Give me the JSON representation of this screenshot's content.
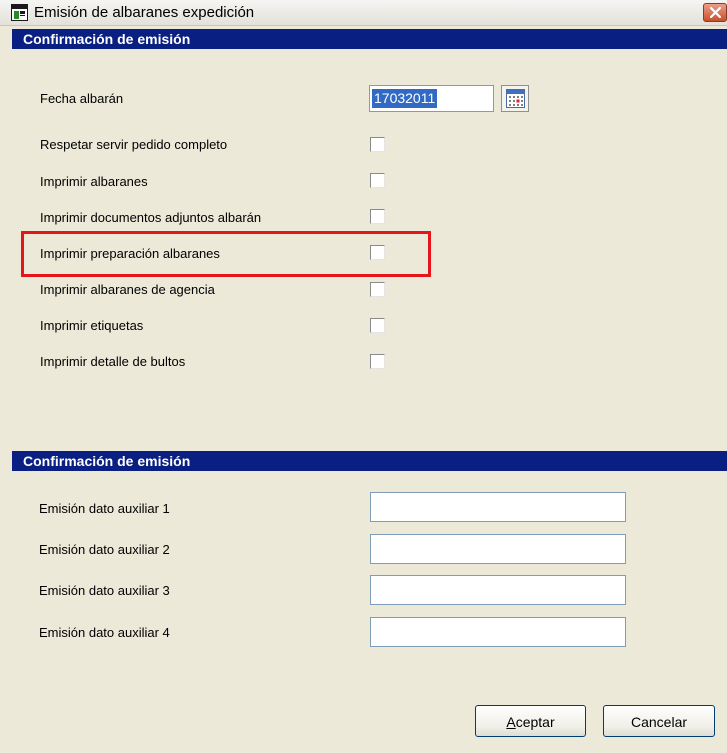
{
  "window": {
    "title": "Emisión de albaranes expedición"
  },
  "section1": {
    "header": "Confirmación de emisión",
    "date": {
      "label": "Fecha albarán",
      "value": "17032011"
    },
    "options": [
      {
        "label": "Respetar servir pedido completo",
        "checked": false
      },
      {
        "label": "Imprimir albaranes",
        "checked": false
      },
      {
        "label": "Imprimir documentos adjuntos albarán",
        "checked": false
      },
      {
        "label": "Imprimir preparación albaranes",
        "checked": false
      },
      {
        "label": "Imprimir albaranes de agencia",
        "checked": false
      },
      {
        "label": "Imprimir etiquetas",
        "checked": false
      },
      {
        "label": "Imprimir detalle de bultos",
        "checked": false
      }
    ]
  },
  "section2": {
    "header": "Confirmación de emisión",
    "fields": [
      {
        "label": "Emisión dato auxiliar 1",
        "value": ""
      },
      {
        "label": "Emisión dato auxiliar 2",
        "value": ""
      },
      {
        "label": "Emisión dato auxiliar 3",
        "value": ""
      },
      {
        "label": "Emisión dato auxiliar 4",
        "value": ""
      }
    ]
  },
  "buttons": {
    "accept_mnemonic": "A",
    "accept_rest": "ceptar",
    "cancel": "Cancelar"
  },
  "colors": {
    "section_header_bg": "#0A1F82",
    "highlight_border": "#E8141C",
    "selection_bg": "#316AC5",
    "window_bg": "#ECE9D8"
  },
  "icons": {
    "app": "window-app-icon",
    "close": "close-icon",
    "calendar": "calendar-icon"
  }
}
